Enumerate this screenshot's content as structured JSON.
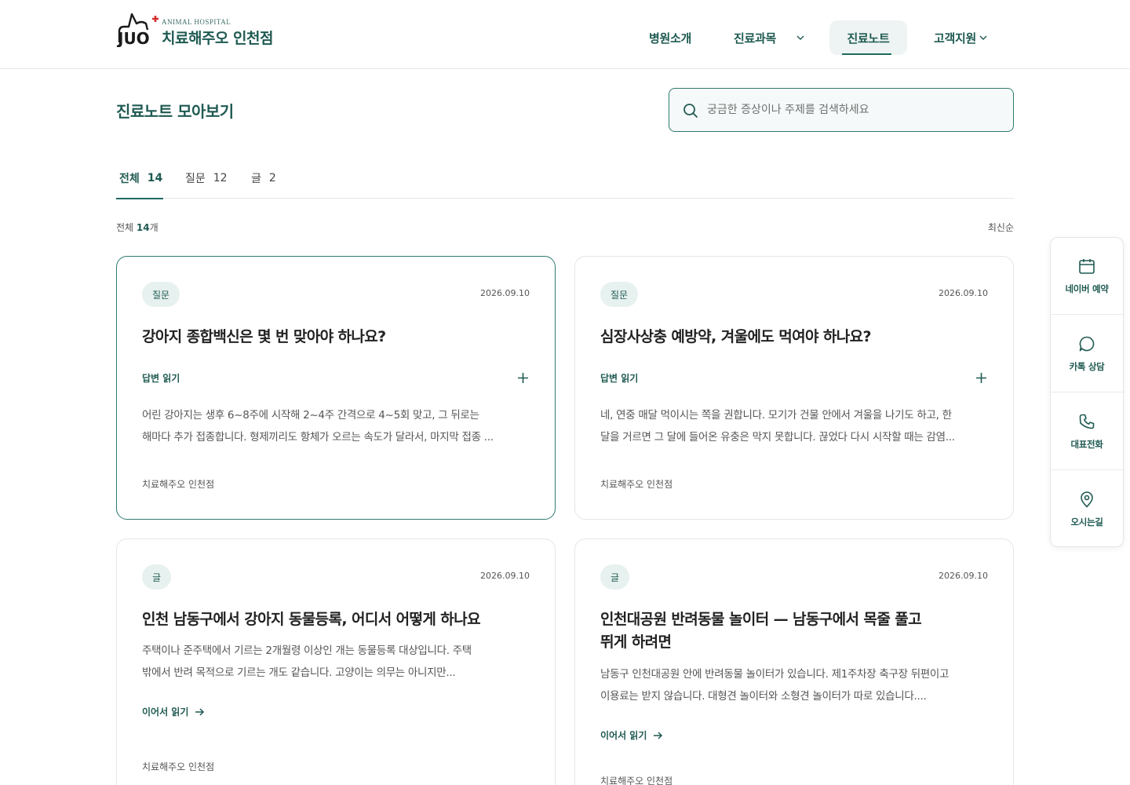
{
  "header": {
    "logo_sub": "ANIMAL HOSPITAL",
    "logo_name": "치료해주오 인천점",
    "nav": [
      {
        "label": "병원소개"
      },
      {
        "label": "진료과목"
      },
      {
        "label": "진료노트",
        "active": true
      },
      {
        "label": "고객지원"
      }
    ]
  },
  "page": {
    "title": "진료노트 모아보기",
    "search_placeholder": "궁금한 증상이나 주제를 검색하세요",
    "tabs": [
      {
        "label": "전체",
        "count": "14",
        "active": true
      },
      {
        "label": "질문",
        "count": "12"
      },
      {
        "label": "글",
        "count": "2"
      }
    ],
    "count_prefix": "전체",
    "count_value": "14",
    "count_suffix": "개",
    "sort_label": "최신순"
  },
  "cards": [
    {
      "badge": "질문",
      "date": "2026.09.10",
      "title": "강아지 종합백신은 몇 번 맞아야 하나요?",
      "answer_label": "답변 읽기",
      "body_line1": "어린 강아지는 생후 6~8주에 시작해 2~4주 간격으로 4~5회 맞고, 그 뒤로는",
      "body_line2": "해마다 추가 접종합니다. 형제끼리도 항체가 오르는 속도가 달라서, 마지막 접종 ...",
      "author": "치료해주오 인천점"
    },
    {
      "badge": "질문",
      "date": "2026.09.10",
      "title": "심장사상충 예방약, 겨울에도 먹여야 하나요?",
      "answer_label": "답변 읽기",
      "body_line1": "네, 연중 매달 먹이시는 쪽을 권합니다. 모기가 건물 안에서 겨울을 나기도 하고, 한",
      "body_line2": "달을 거르면 그 달에 들어온 유충은 막지 못합니다. 끊었다 다시 시작할 때는 감염...",
      "author": "치료해주오 인천점"
    },
    {
      "badge": "글",
      "date": "2026.09.10",
      "title_line1": "인천 남동구에서 강아지 동물등록, 어디서 어떻게 하나요",
      "body_line1": "주택이나 준주택에서 기르는 2개월령 이상인 개는 동물등록 대상입니다. 주택",
      "body_line2": "밖에서 반려 목적으로 기르는 개도 같습니다. 고양이는 의무는 아니지만...",
      "more_label": "이어서 읽기",
      "author": "치료해주오 인천점"
    },
    {
      "badge": "글",
      "date": "2026.09.10",
      "title_line1": "인천대공원 반려동물 놀이터 — 남동구에서 목줄 풀고",
      "title_line2": "뛰게 하려면",
      "body_line1": "남동구 인천대공원 안에 반려동물 놀이터가 있습니다. 제1주차장 축구장 뒤편이고",
      "body_line2": "이용료는 받지 않습니다. 대형견 놀이터와 소형견 놀이터가 따로 있습니다....",
      "more_label": "이어서 읽기",
      "author": "치료해주오 인천점"
    }
  ],
  "side": [
    {
      "label": "네이버 예약",
      "icon": "calendar-icon"
    },
    {
      "label": "카톡 상담",
      "icon": "chat-bubble-icon"
    },
    {
      "label": "대표전화",
      "icon": "phone-icon"
    },
    {
      "label": "오시는길",
      "icon": "map-pin-icon"
    }
  ],
  "colors": {
    "accent": "#1f5a52",
    "accent_border": "#2f7a70",
    "badge_bg": "#e7f1ef"
  }
}
